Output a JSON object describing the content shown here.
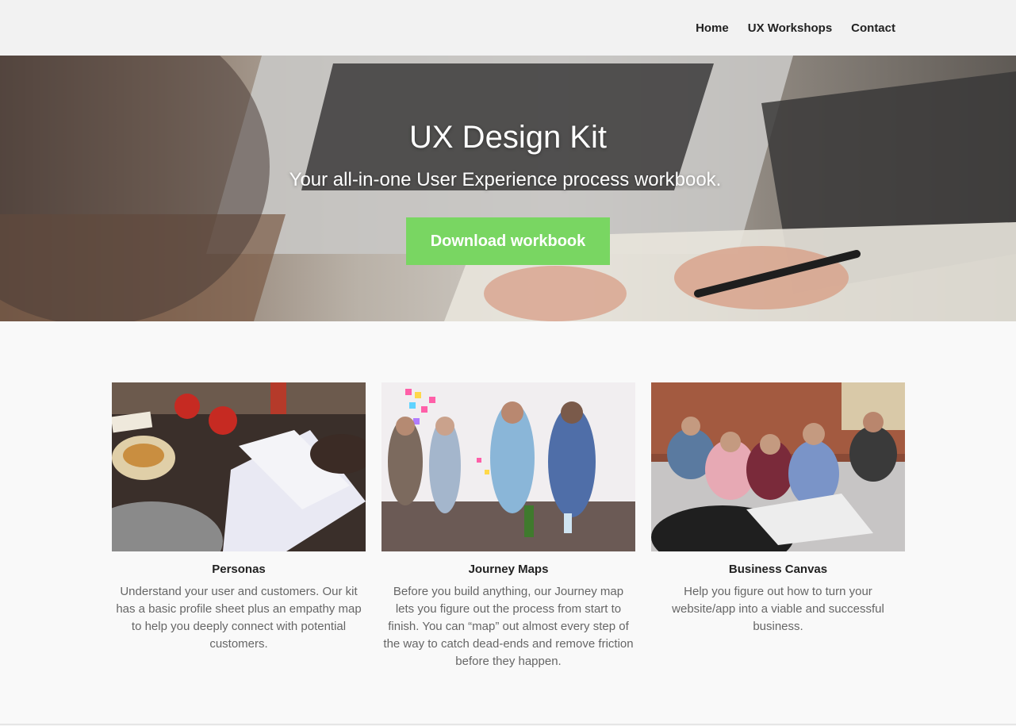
{
  "nav": {
    "items": [
      {
        "label": "Home"
      },
      {
        "label": "UX Workshops"
      },
      {
        "label": "Contact"
      }
    ]
  },
  "hero": {
    "title": "UX Design Kit",
    "subtitle": "Your all-in-one User Experience process workbook.",
    "button_label": "Download workbook",
    "button_color": "#79d662"
  },
  "features": [
    {
      "title": "Personas",
      "text": "Understand your user and customers. Our kit has a basic profile sheet plus an empathy map to help you deeply connect with potential customers."
    },
    {
      "title": "Journey Maps",
      "text": "Before you build anything, our Journey map lets you figure out the process from start to finish. You can “map” out almost every step of the way to catch dead-ends and remove friction before they happen."
    },
    {
      "title": "Business Canvas",
      "text": "Help you figure out how to turn your website/app into a viable and successful business."
    }
  ]
}
